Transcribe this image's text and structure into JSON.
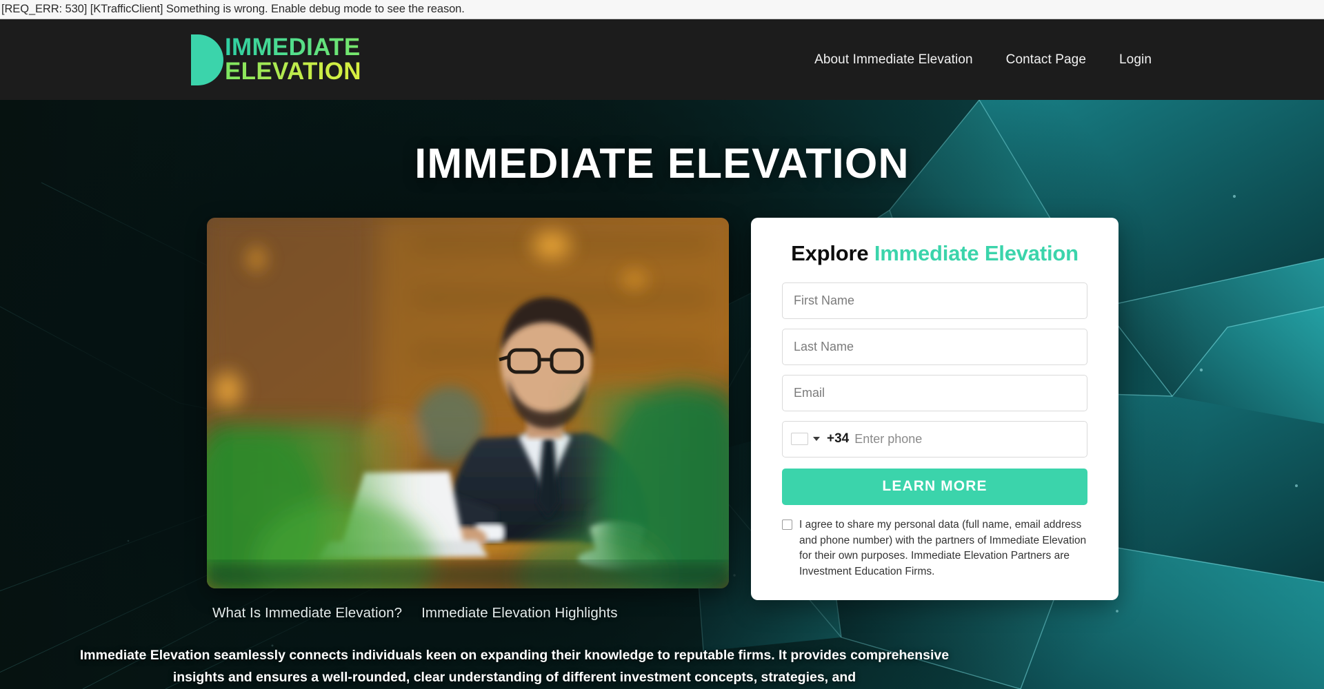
{
  "error_bar": {
    "message": "[REQ_ERR: 530] [KTrafficClient] Something is wrong. Enable debug mode to see the reason."
  },
  "nav": {
    "logo": {
      "mark_icon": "half-circle-icon",
      "line1": "IMMEDIATE",
      "line2": "ELEVATION",
      "color_teal": "#3bd4ab",
      "color_lime": "#d9ef3f"
    },
    "links": [
      {
        "label": "About Immediate Elevation"
      },
      {
        "label": "Contact Page"
      },
      {
        "label": "Login"
      }
    ]
  },
  "hero": {
    "title": "IMMEDIATE ELEVATION",
    "image_alt": "businessman-at-laptop-photo",
    "tabs": [
      {
        "label": "What Is Immediate Elevation?"
      },
      {
        "label": "Immediate Elevation Highlights"
      }
    ],
    "blurb": "Immediate Elevation seamlessly connects individuals keen on expanding their knowledge to reputable firms. It provides comprehensive insights and ensures a well-rounded, clear understanding of different investment concepts, strategies, and"
  },
  "form": {
    "title_plain": "Explore ",
    "title_accent": "Immediate Elevation",
    "first_name_placeholder": "First Name",
    "last_name_placeholder": "Last Name",
    "email_placeholder": "Email",
    "dial_code": "+34",
    "phone_placeholder": "Enter phone",
    "submit_label": "LEARN MORE",
    "consent_text": "I agree to share my personal data (full name, email address and phone number) with the partners of Immediate Elevation for their own purposes. Immediate Elevation Partners are Investment Education Firms.",
    "accent_color": "#3bd4ab"
  }
}
